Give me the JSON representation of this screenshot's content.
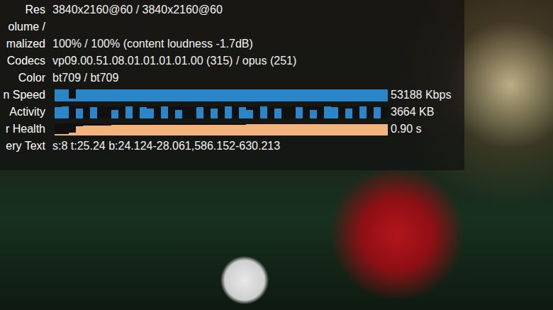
{
  "video": {
    "playing": true
  },
  "rows": [
    {
      "kind": "text",
      "label": [
        "Res"
      ],
      "value": "3840x2160@60 / 3840x2160@60"
    },
    {
      "kind": "text",
      "label": [
        "olume /",
        "malized"
      ],
      "value": "100% / 100% (content loudness -1.7dB)"
    },
    {
      "kind": "text",
      "label": [
        "Codecs"
      ],
      "value": "vp09.00.51.08.01.01.01.01.00 (315) / opus (251)"
    },
    {
      "kind": "text",
      "label": [
        "Color"
      ],
      "value": "bt709 / bt709"
    },
    {
      "kind": "graph",
      "label": [
        "n Speed"
      ],
      "reading": "53188 Kbps",
      "color": "#2a86c8",
      "values": [
        1,
        1,
        0.2,
        1,
        1,
        1,
        1,
        1,
        1,
        1,
        1,
        1,
        1,
        1,
        1,
        1,
        1,
        1,
        1,
        1,
        1,
        1,
        1,
        1,
        1,
        1,
        1,
        1,
        1,
        1,
        1,
        1,
        1,
        1,
        1,
        1,
        1,
        1,
        1,
        1,
        1,
        1,
        1,
        1,
        1,
        1,
        1
      ]
    },
    {
      "kind": "graph",
      "label": [
        "Activity"
      ],
      "reading": "3664 KB",
      "color": "#2a86c8",
      "values": [
        0.9,
        1,
        0,
        0.8,
        0,
        0.9,
        0,
        0,
        0.7,
        0,
        1,
        0,
        0.9,
        0.8,
        0,
        1,
        0,
        0.7,
        0,
        0,
        0.9,
        0,
        0.8,
        0,
        1,
        0,
        0.9,
        0.7,
        0,
        1,
        0,
        0.8,
        0,
        0,
        0.9,
        0,
        0.7,
        0,
        1,
        0.9,
        0,
        0.8,
        0,
        1,
        0,
        0.9,
        0
      ]
    },
    {
      "kind": "graph",
      "label": [
        "r Health"
      ],
      "reading": "0.90 s",
      "color": "#f4b27c",
      "values": [
        0.1,
        0.1,
        0.2,
        0.75,
        0.78,
        0.8,
        0.8,
        0.82,
        0.83,
        0.84,
        0.84,
        0.85,
        0.85,
        0.85,
        0.86,
        0.86,
        0.86,
        0.87,
        0.87,
        0.87,
        0.87,
        0.88,
        0.88,
        0.88,
        0.88,
        0.88,
        0.88,
        0.89,
        0.89,
        0.89,
        0.89,
        0.89,
        0.89,
        0.89,
        0.9,
        0.9,
        0.9,
        0.9,
        0.9,
        0.9,
        0.9,
        0.9,
        0.9,
        0.9,
        0.9,
        0.9,
        0.9
      ]
    },
    {
      "kind": "text",
      "label": [
        "ery Text"
      ],
      "value": "s:8 t:25.24 b:24.124-28.061,586.152-630.213"
    }
  ]
}
